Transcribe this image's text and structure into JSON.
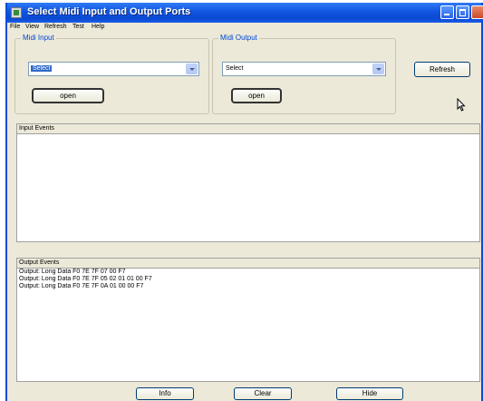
{
  "window": {
    "title": "Select Midi Input and Output Ports"
  },
  "menu": [
    "File",
    "View",
    "Refresh",
    "Test",
    "Help"
  ],
  "midi_input": {
    "label": "Midi Input",
    "select_value": "Select",
    "open_label": "open"
  },
  "midi_output": {
    "label": "Midi Output",
    "select_value": "Select",
    "open_label": "open"
  },
  "refresh_label": "Refresh",
  "input_events": {
    "header": "Input Events",
    "lines": []
  },
  "output_events": {
    "header": "Output Events",
    "lines": [
      "Output: Long Data F0 7E 7F 07 00 F7",
      "Output: Long Data F0 7E 7F 05 02 01 01 00 F7",
      "Output: Long Data F0 7E 7F 0A 01 00 00 F7"
    ]
  },
  "footer": {
    "info_label": "Info",
    "clear_label": "Clear",
    "hide_label": "Hide"
  },
  "colors": {
    "titlebar": "#0b49d2",
    "legend": "#0046d5",
    "selection": "#316ac5"
  }
}
